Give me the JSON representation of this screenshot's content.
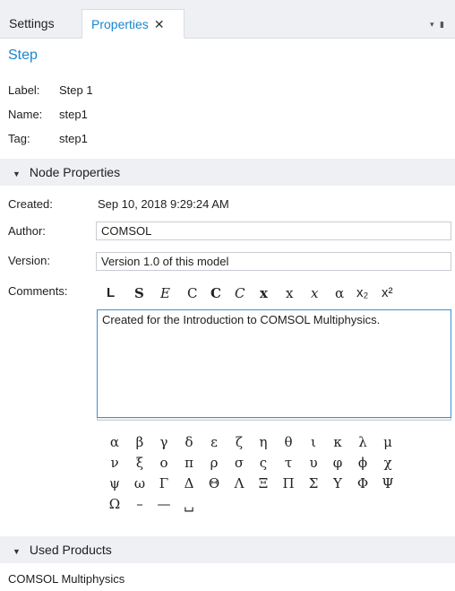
{
  "tabs": [
    {
      "label": "Settings"
    },
    {
      "label": "Properties",
      "close": "✕"
    }
  ],
  "pane_menu": "▾ ▮",
  "node_title": "Step",
  "identity": {
    "label_key": "Label:",
    "label_value": "Step 1",
    "name_key": "Name:",
    "name_value": "step1",
    "tag_key": "Tag:",
    "tag_value": "step1"
  },
  "node_properties": {
    "header": "Node Properties",
    "created_label": "Created:",
    "created_value": "Sep 10, 2018 9:29:24 AM",
    "author_label": "Author:",
    "author_value": "COMSOL",
    "version_label": "Version:",
    "version_value": "Version 1.0 of this model",
    "comments_label": "Comments:",
    "comments_value": "Created for the Introduction to COMSOL Multiphysics."
  },
  "format_buttons": [
    "L",
    "S",
    "E",
    "C",
    "C",
    "C",
    "x",
    "x",
    "x",
    "α",
    "x₂",
    "x²"
  ],
  "greek_rows": [
    [
      "α",
      "β",
      "γ",
      "δ",
      "ε",
      "ζ",
      "η",
      "θ",
      "ι",
      "κ",
      "λ",
      "μ"
    ],
    [
      "ν",
      "ξ",
      "ο",
      "π",
      "ρ",
      "σ",
      "ς",
      "τ",
      "υ",
      "φ",
      "ϕ",
      "χ"
    ],
    [
      "ψ",
      "ω",
      "Γ",
      "Δ",
      "Θ",
      "Λ",
      "Ξ",
      "Π",
      "Σ",
      "Υ",
      "Φ",
      "Ψ"
    ],
    [
      "Ω",
      "–",
      "—",
      "␣"
    ]
  ],
  "used_products": {
    "header": "Used Products",
    "items": [
      "COMSOL Multiphysics"
    ]
  },
  "colors": {
    "accent": "#1a86d0",
    "section_bg": "#eef0f3",
    "focus_border": "#3d8fd1"
  }
}
